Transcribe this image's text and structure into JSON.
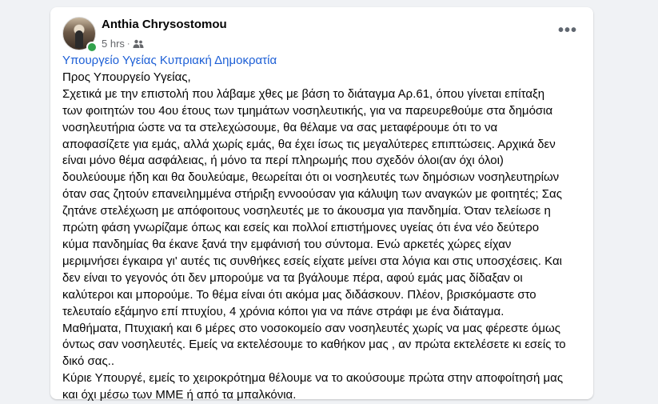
{
  "post": {
    "author": "Anthia Chrysostomou",
    "time": "5 hrs",
    "separator": "·",
    "audience_icon": "friends-icon",
    "more_label": "•••",
    "mention": "Υπουργείο Υγείας Κυπριακή Δημοκρατία",
    "lines": [
      "Προς Υπουργείο Υγείας,",
      "Σχετικά με την επιστολή που λάβαμε χθες με βάση το διάταγμα Αρ.61, όπου γίνεται επίταξη",
      "των φοιτητών του 4ου έτους των τμημάτων νοσηλευτικής, για να παρευρεθούμε στα δημόσια",
      "νοσηλευτήρια ώστε να τα στελεχώσουμε, θα θέλαμε να σας μεταφέρουμε ότι το να",
      "αποφασίζετε για εμάς, αλλά χωρίς εμάς, θα έχει ίσως τις μεγαλύτερες επιπτώσεις. Αρχικά δεν",
      "είναι μόνο θέμα ασφάλειας, ή μόνο τα περί πληρωμής που σχεδόν όλοι(αν όχι όλοι)",
      "δουλεύουμε ήδη και θα δουλεύαμε, θεωρείται ότι οι νοσηλευτές των δημόσιων νοσηλευτηρίων",
      "όταν σας ζητούν επανειλημμένα στήριξη εννοούσαν για κάλυψη των αναγκών με φοιτητές; Σας",
      "ζητάνε στελέχωση με απόφοιτους νοσηλευτές με το άκουσμα για πανδημία. Όταν τελείωσε η",
      "πρώτη φάση γνωρίζαμε όπως και εσείς και πολλοί επιστήμονες υγείας ότι ένα νέο δεύτερο",
      "κύμα πανδημίας θα έκανε ξανά την εμφάνισή του σύντομα. Ενώ αρκετές χώρες είχαν",
      "μεριμνήσει έγκαιρα γι' αυτές τις συνθήκες εσείς είχατε μείνει στα λόγια και στις υποσχέσεις. Και",
      "δεν είναι το γεγονός ότι δεν μπορούμε να τα βγάλουμε πέρα, αφού εμάς μας δίδαξαν οι",
      "καλύτεροι και μπορούμε. Το θέμα είναι ότι ακόμα μας διδάσκουν. Πλέον, βρισκόμαστε στο",
      "τελευταίο εξάμηνο επί πτυχίου, 4 χρόνια κόποι για να πάνε στράφι με ένα διάταγμα.",
      "Μαθήματα, Πτυχιακή και 6 μέρες στο νοσοκομείο σαν νοσηλευτές χωρίς να μας φέρεστε όμως",
      "όντως σαν νοσηλευτές. Εμείς να εκτελέσουμε το καθήκον μας , αν πρώτα εκτελέσετε κι εσείς το",
      "δικό σας..",
      "Κύριε Υπουργέ, εμείς το χειροκρότημα θέλουμε να το ακούσουμε πρώτα στην αποφοίτησή μας",
      "και όχι μέσω των ΜΜΕ ή από τα μπαλκόνια."
    ]
  },
  "colors": {
    "background": "#f0f2f5",
    "card": "#ffffff",
    "mention": "#1d5fd6",
    "meta": "#65676b",
    "online": "#31a24c"
  }
}
